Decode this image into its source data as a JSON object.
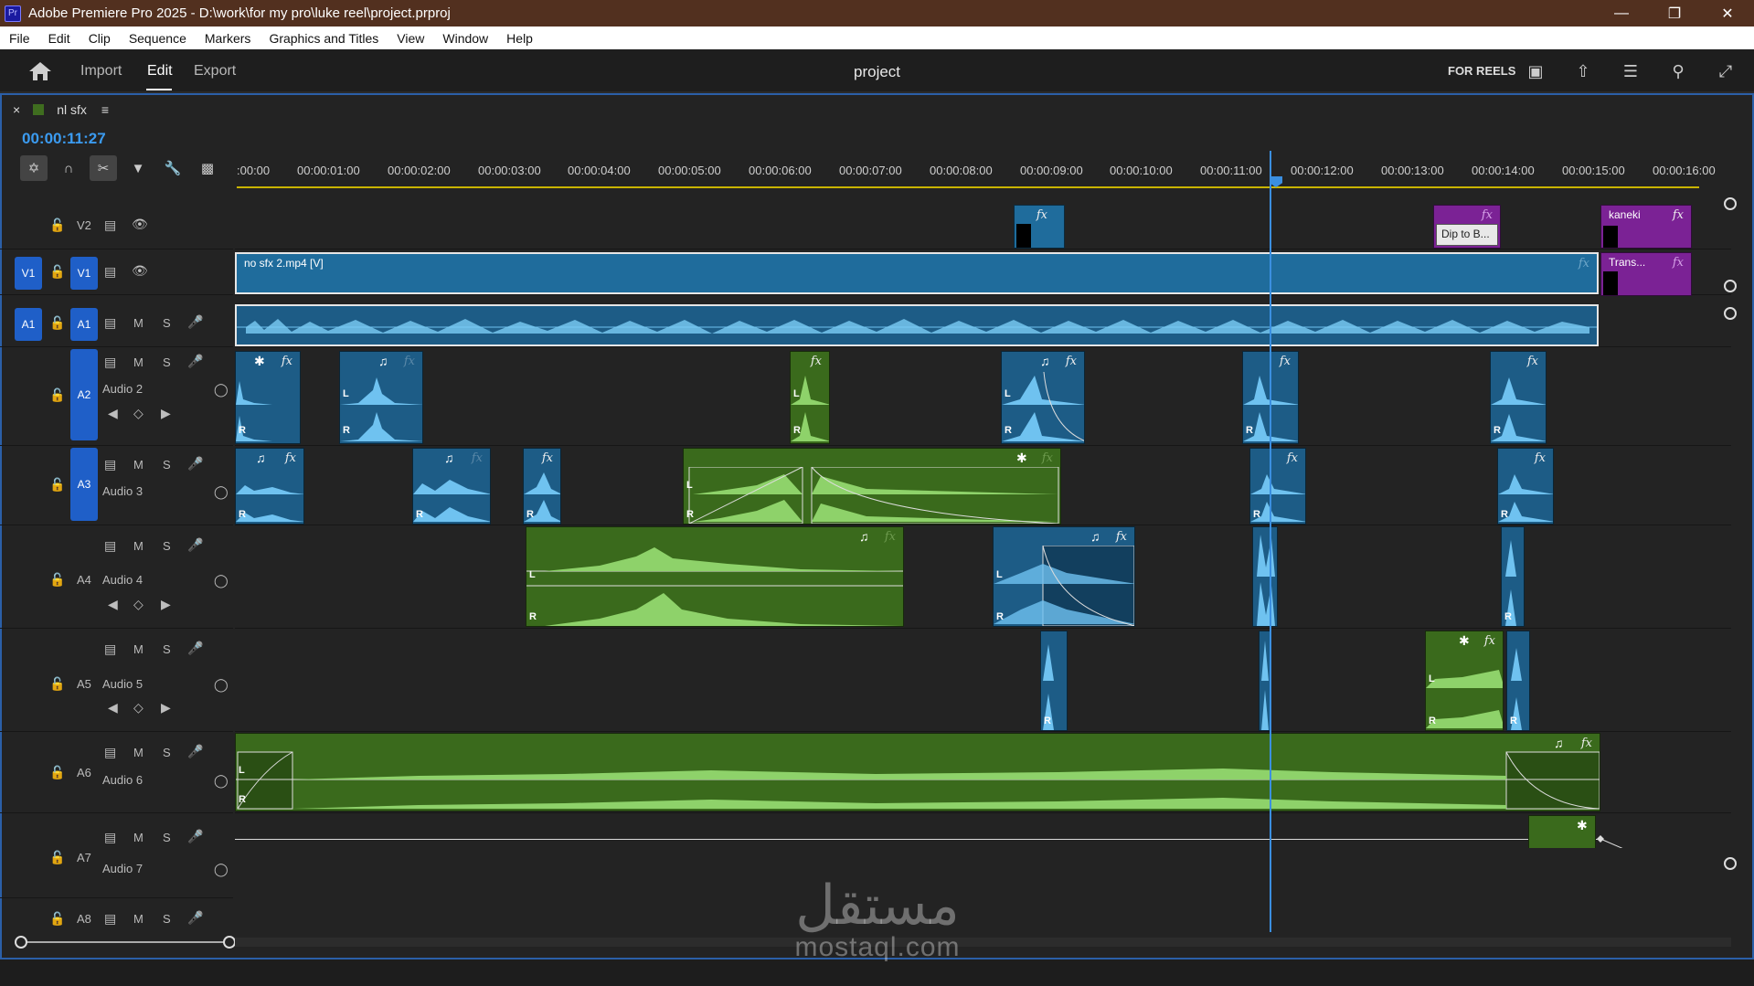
{
  "window": {
    "title": "Adobe Premiere Pro 2025 - D:\\work\\for my pro\\luke reel\\project.prproj",
    "app_icon": "Pr"
  },
  "menu": [
    "File",
    "Edit",
    "Clip",
    "Sequence",
    "Markers",
    "Graphics and Titles",
    "View",
    "Window",
    "Help"
  ],
  "workspace": {
    "tabs": [
      "Import",
      "Edit",
      "Export"
    ],
    "active": "Edit",
    "project_title": "project",
    "reels_label": "FOR REELS"
  },
  "sequence": {
    "tab_name": "nl sfx",
    "timecode": "00:00:11:27",
    "ruler_labels": [
      ":00:00",
      "00:00:01:00",
      "00:00:02:00",
      "00:00:03:00",
      "00:00:04:00",
      "00:00:05:00",
      "00:00:06:00",
      "00:00:07:00",
      "00:00:08:00",
      "00:00:09:00",
      "00:00:10:00",
      "00:00:11:00",
      "00:00:12:00",
      "00:00:13:00",
      "00:00:14:00",
      "00:00:15:00",
      "00:00:16:00"
    ]
  },
  "tracks": {
    "v2": {
      "label": "V2"
    },
    "v1": {
      "label": "V1",
      "source": "V1"
    },
    "a1": {
      "label": "A1",
      "source": "A1"
    },
    "a2": {
      "label": "A2",
      "name": "Audio 2"
    },
    "a3": {
      "label": "A3",
      "name": "Audio 3"
    },
    "a4": {
      "label": "A4",
      "name": "Audio 4"
    },
    "a5": {
      "label": "A5",
      "name": "Audio 5"
    },
    "a6": {
      "label": "A6",
      "name": "Audio 6"
    },
    "a7": {
      "label": "A7",
      "name": "Audio 7"
    },
    "a8": {
      "label": "A8"
    }
  },
  "track_buttons": {
    "mute": "M",
    "solo": "S"
  },
  "clips": {
    "v1_main": "no sfx 2.mp4 [V]",
    "v2_dip": "Dip to B...",
    "v2_kaneki": "kaneki",
    "v1_trans": "Trans...",
    "fx": "fx",
    "left": "L",
    "right": "R"
  },
  "watermark": {
    "arabic": "مستقل",
    "latin": "mostaql.com"
  },
  "colors": {
    "titlebar": "#52301f",
    "timecode": "#3b9bf0",
    "video_clip": "#1f6c9c",
    "audio_clip_blue": "#1d5c86",
    "audio_clip_green": "#3a6a1c",
    "graphic_clip": "#7b2295",
    "playhead": "#3b8fe0",
    "work_area": "#c9b400",
    "track_target": "#1f5fc8"
  }
}
